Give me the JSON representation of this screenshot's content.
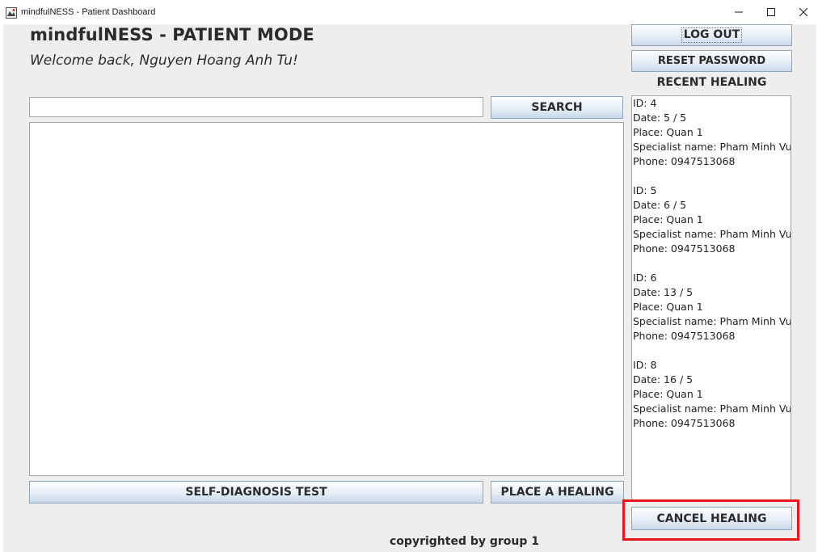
{
  "window": {
    "title": "mindfulNESS - Patient Dashboard",
    "minimize_glyph": "–",
    "maximize_glyph": "☐",
    "close_glyph": "✕"
  },
  "header": {
    "app_title": "mindfulNESS - PATIENT MODE",
    "welcome": "Welcome back, Nguyen Hoang Anh Tu!"
  },
  "account": {
    "logout_label": "LOG OUT",
    "reset_password_label": "RESET PASSWORD"
  },
  "search": {
    "value": "",
    "placeholder": "",
    "button_label": "SEARCH"
  },
  "recent": {
    "label": "RECENT HEALING",
    "records": [
      {
        "id": "ID: 4",
        "date": "Date: 5 / 5",
        "place": "Place: Quan 1",
        "specialist": "Specialist name: Pham Minh Vu",
        "phone": "Phone: 0947513068"
      },
      {
        "id": "ID: 5",
        "date": "Date: 6 / 5",
        "place": "Place: Quan 1",
        "specialist": "Specialist name: Pham Minh Vu",
        "phone": "Phone: 0947513068"
      },
      {
        "id": "ID: 6",
        "date": "Date: 13 / 5",
        "place": "Place: Quan 1",
        "specialist": "Specialist name: Pham Minh Vu",
        "phone": "Phone: 0947513068"
      },
      {
        "id": "ID: 8",
        "date": "Date: 16 / 5",
        "place": "Place: Quan 1",
        "specialist": "Specialist name: Pham Minh Vu",
        "phone": "Phone: 0947513068"
      }
    ]
  },
  "actions": {
    "self_diagnosis_label": "SELF-DIAGNOSIS TEST",
    "place_healing_label": "PLACE A HEALING",
    "cancel_healing_label": "CANCEL HEALING"
  },
  "footer": {
    "copyright": "copyrighted by group 1"
  },
  "colors": {
    "highlight": "#e8141b",
    "background": "#eeeeee"
  }
}
